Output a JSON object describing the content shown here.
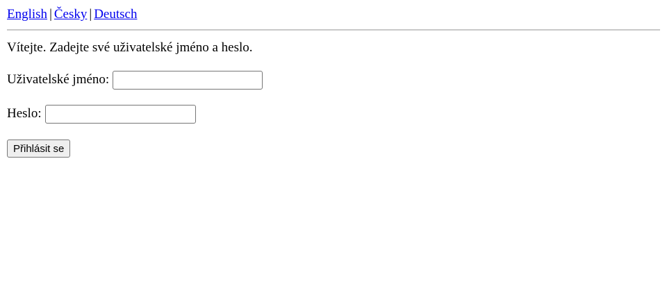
{
  "languages": {
    "english": "English",
    "czech": "Česky",
    "german": "Deutsch",
    "separator": "|"
  },
  "welcome_text": "Vítejte. Zadejte své uživatelské jméno a heslo.",
  "login_form": {
    "username_label": "Uživatelské jméno:",
    "username_value": "",
    "password_label": "Heslo:",
    "password_value": "",
    "submit_label": "Přihlásit se"
  },
  "colors": {
    "link": "#0000ee",
    "divider": "#c8c8c8",
    "button_bg": "#efefef"
  }
}
